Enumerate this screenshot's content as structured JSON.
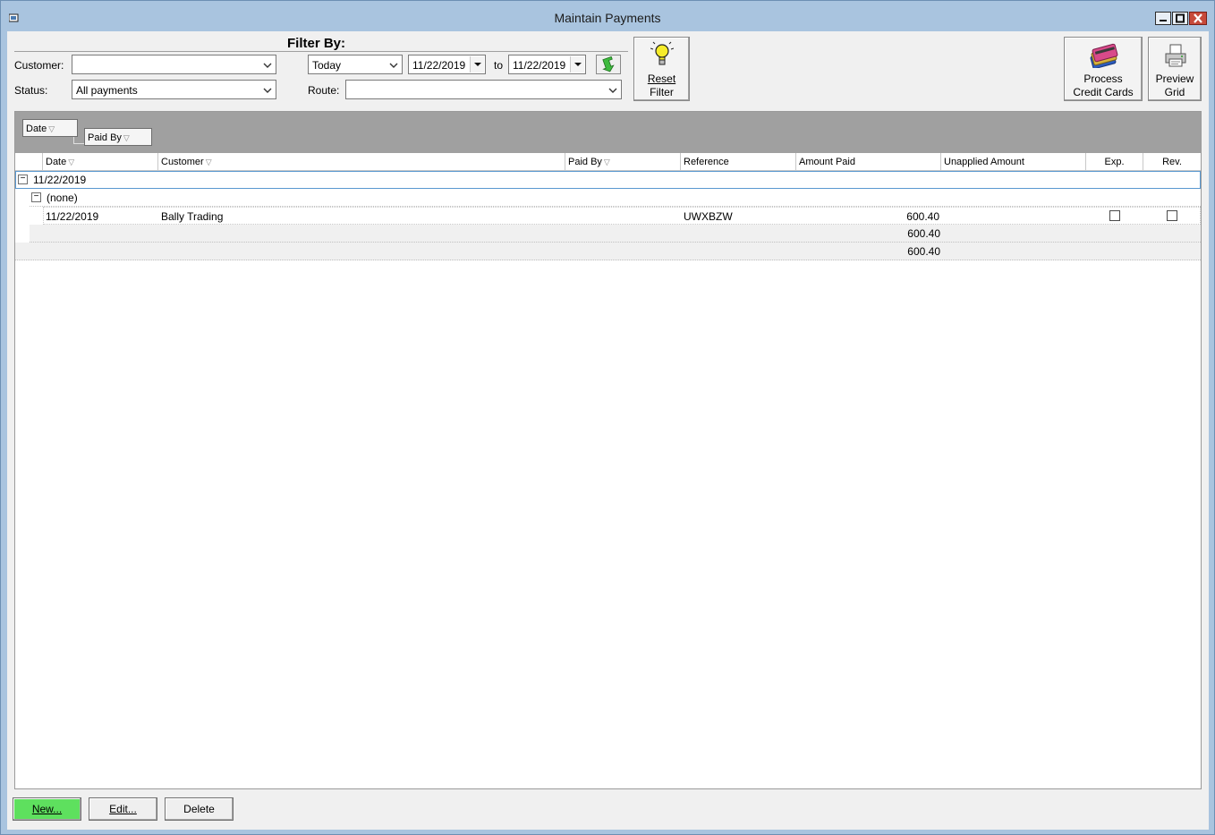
{
  "window": {
    "title": "Maintain Payments"
  },
  "filter": {
    "heading": "Filter By:",
    "customer_label": "Customer:",
    "customer_value": "",
    "status_label": "Status:",
    "status_value": "All payments",
    "period_value": "Today",
    "date_from": "11/22/2019",
    "to_label": "to",
    "date_to": "11/22/2019",
    "route_label": "Route:",
    "route_value": ""
  },
  "toolbar": {
    "reset_filter_line1": "Reset",
    "reset_filter_line2": "Filter",
    "process_cc_line1": "Process",
    "process_cc_line2": "Credit Cards",
    "preview_line1": "Preview",
    "preview_line2": "Grid"
  },
  "grouping": {
    "chips": [
      "Date",
      "Paid By"
    ]
  },
  "grid": {
    "columns": [
      "Date",
      "Customer",
      "Paid By",
      "Reference",
      "Amount Paid",
      "Unapplied Amount",
      "Exp.",
      "Rev."
    ],
    "group1": "11/22/2019",
    "group2": "(none)",
    "rows": [
      {
        "date": "11/22/2019",
        "customer": "Bally Trading",
        "paid_by": "",
        "reference": "UWXBZW",
        "amount_paid": "600.40",
        "unapplied": "",
        "exp": false,
        "rev": false
      }
    ],
    "subtotal": "600.40",
    "total": "600.40"
  },
  "buttons": {
    "new": "New...",
    "edit": "Edit...",
    "delete": "Delete"
  },
  "colors": {
    "new_button": "#5ee05e",
    "grouping_area": "#a0a0a0",
    "title_bar": "#a9c4df"
  }
}
